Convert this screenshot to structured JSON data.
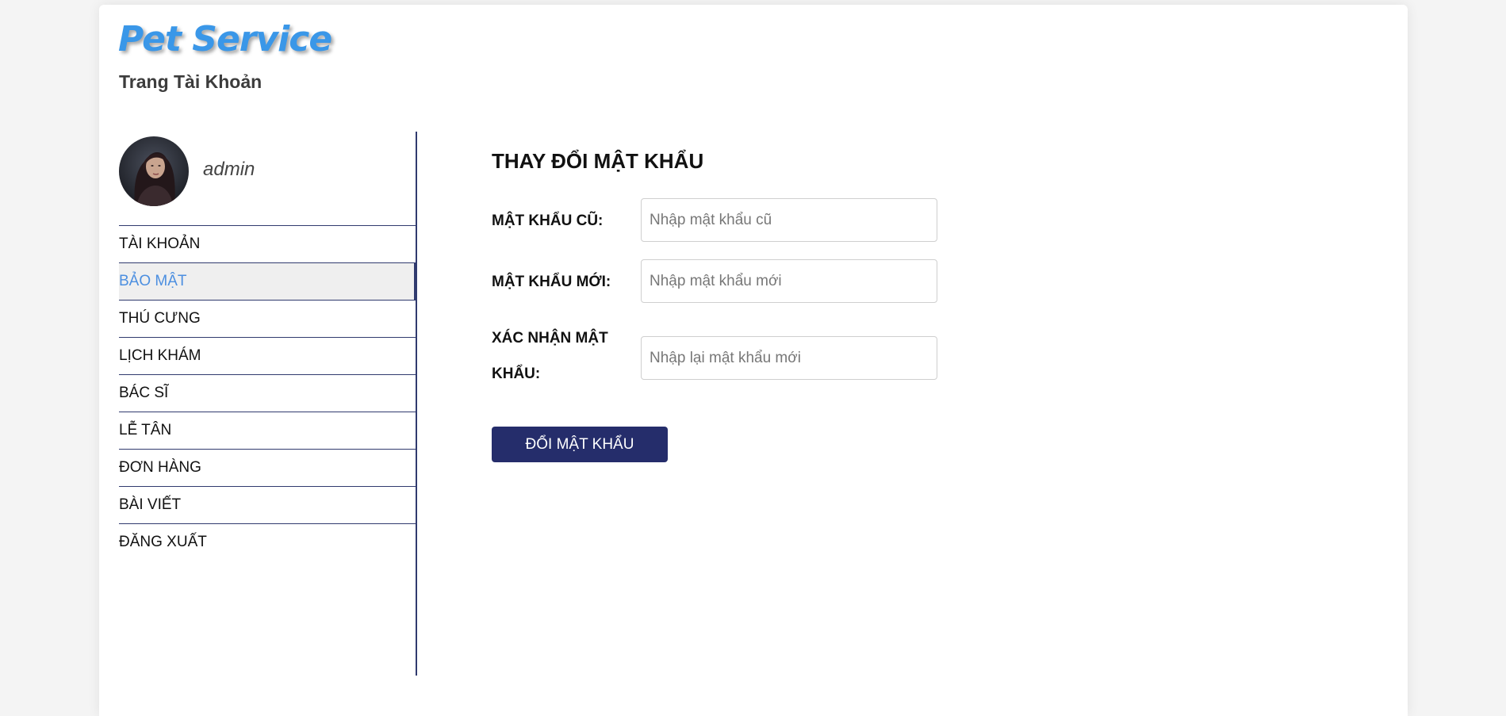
{
  "brand": {
    "logo": "Pet Service",
    "subtitle": "Trang Tài Khoản",
    "accent": "#3a97e8"
  },
  "profile": {
    "username": "admin"
  },
  "sidebar": {
    "items": [
      {
        "label": "TÀI KHOẢN",
        "active": false
      },
      {
        "label": "BẢO MẬT",
        "active": true
      },
      {
        "label": "THÚ CƯNG",
        "active": false
      },
      {
        "label": "LỊCH KHÁM",
        "active": false
      },
      {
        "label": "BÁC SĨ",
        "active": false
      },
      {
        "label": "LỄ TÂN",
        "active": false
      },
      {
        "label": "ĐƠN HÀNG",
        "active": false
      },
      {
        "label": "BÀI VIẾT",
        "active": false
      },
      {
        "label": "ĐĂNG XUẤT",
        "active": false
      }
    ],
    "active_color": "#4c8fe0",
    "border_color": "#303a6e"
  },
  "form": {
    "title": "THAY ĐỔI MẬT KHẨU",
    "old_password": {
      "label": "MẬT KHẨU CŨ:",
      "placeholder": "Nhập mật khẩu cũ",
      "value": ""
    },
    "new_password": {
      "label": "MẬT KHẨU MỚI:",
      "placeholder": "Nhập mật khẩu mới",
      "value": ""
    },
    "confirm_password": {
      "label": "XÁC NHẬN MẬT KHẨU:",
      "placeholder": "Nhập lại mật khẩu mới",
      "value": ""
    },
    "submit_label": "ĐỔI MẬT KHẨU",
    "button_color": "#252d6b"
  }
}
